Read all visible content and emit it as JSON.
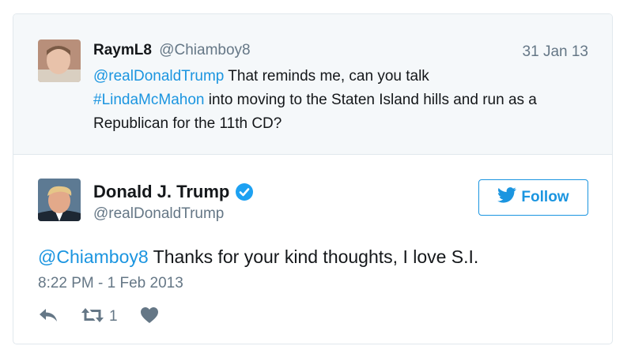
{
  "parent_tweet": {
    "name": "RaymL8",
    "handle": "@Chiamboy8",
    "date": "31 Jan 13",
    "mention": "@realDonaldTrump",
    "text_1": " That reminds me, can you talk",
    "hashtag": "#LindaMcMahon",
    "text_2": " into moving to the Staten Island hills and run as a Republican for the 11th CD?"
  },
  "main_tweet": {
    "name": "Donald J. Trump",
    "handle": "@realDonaldTrump",
    "follow_label": "Follow",
    "mention": "@Chiamboy8",
    "text": " Thanks for your kind thoughts, I love S.I.",
    "timestamp": "8:22 PM - 1 Feb 2013",
    "retweet_count": "1"
  },
  "icons": {
    "verified": "verified-badge-icon",
    "bird": "twitter-bird-icon",
    "reply": "reply-icon",
    "retweet": "retweet-icon",
    "like": "heart-icon"
  },
  "colors": {
    "link": "#1b95e0",
    "muted": "#657786",
    "icon": "#657786",
    "parent_bg": "#f5f8fa",
    "border": "#e1e8ed"
  }
}
